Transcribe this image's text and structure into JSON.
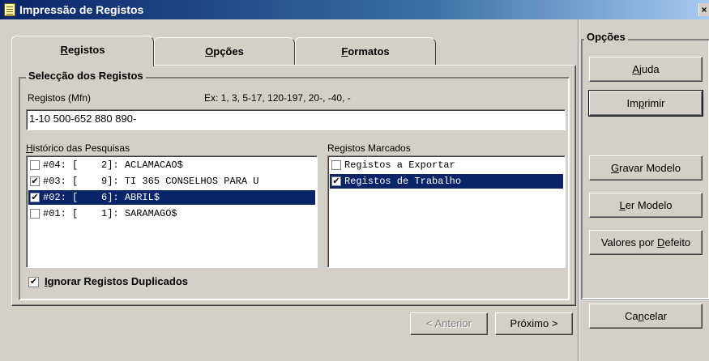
{
  "window": {
    "title": "Impressão de Registos",
    "close_glyph": "×"
  },
  "tabs": [
    {
      "pre": "",
      "u": "R",
      "post": "egistos"
    },
    {
      "pre": "",
      "u": "O",
      "post": "pções"
    },
    {
      "pre": "",
      "u": "F",
      "post": "ormatos"
    }
  ],
  "selection": {
    "group_title": "Selecção dos Registos",
    "field_label": "Registos (Mfn)",
    "example": "Ex: 1,  3,  5-17, 120-197, 20-, -40, -",
    "field_value": "1-10 500-652 880 890-"
  },
  "history": {
    "label_u": "H",
    "label_rest": "istórico das Pesquisas",
    "items": [
      {
        "text": "#04: [    2]: ACLAMACAO$",
        "checked": false,
        "selected": false
      },
      {
        "text": "#03: [    9]: TI 365 CONSELHOS PARA U",
        "checked": true,
        "selected": false
      },
      {
        "text": "#02: [    6]: ABRIL$",
        "checked": true,
        "selected": true
      },
      {
        "text": "#01: [    1]: SARAMAGO$",
        "checked": false,
        "selected": false
      }
    ]
  },
  "marked": {
    "label": "Registos Marcados",
    "items": [
      {
        "text": "Registos a Exportar",
        "checked": false,
        "selected": false
      },
      {
        "text": "Registos de Trabalho",
        "checked": true,
        "selected": true
      }
    ]
  },
  "ignore_duplicates": {
    "label_u": "I",
    "label_rest": "gnorar Registos Duplicados",
    "checked": true
  },
  "nav": {
    "prev": "< Anterior",
    "next": "Próximo >"
  },
  "options": {
    "title": "Opções",
    "buttons": [
      {
        "pre": "",
        "u": "A",
        "post": "juda"
      },
      {
        "pre": "Im",
        "u": "p",
        "post": "rimir"
      },
      {
        "pre": "",
        "u": "G",
        "post": "ravar Modelo"
      },
      {
        "pre": "",
        "u": "L",
        "post": "er Modelo"
      },
      {
        "pre": "Valores por ",
        "u": "D",
        "post": "efeito"
      },
      {
        "pre": "Ca",
        "u": "n",
        "post": "celar"
      }
    ]
  },
  "glyphs": {
    "check": "✔"
  }
}
